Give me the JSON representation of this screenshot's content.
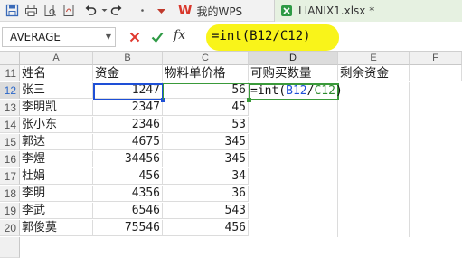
{
  "toolbar": {
    "icons": [
      "save-icon",
      "print-icon",
      "print-preview-icon",
      "export-pdf-icon",
      "undo-icon",
      "redo-icon",
      "customize-quick-access-icon"
    ]
  },
  "tabs": [
    {
      "label": "我的WPS",
      "active": false
    },
    {
      "label": "LIANIX1.xlsx *",
      "active": true
    }
  ],
  "formula_bar": {
    "name_box": "AVERAGE",
    "fx_label": "fx",
    "formula": "=int(B12/C12)"
  },
  "sheet": {
    "columns": [
      "A",
      "B",
      "C",
      "D",
      "E",
      "F"
    ],
    "row_numbers": [
      "11",
      "12",
      "13",
      "14",
      "15",
      "16",
      "17",
      "18",
      "19",
      "20"
    ],
    "header_row": [
      "姓名",
      "资金",
      "物料单价格",
      "可购买数量",
      "剩余资金",
      ""
    ],
    "rows": [
      {
        "name": "张三",
        "fund": "1247",
        "price": "56"
      },
      {
        "name": "李明凯",
        "fund": "2347",
        "price": "45"
      },
      {
        "name": "张小东",
        "fund": "2346",
        "price": "53"
      },
      {
        "name": "郭达",
        "fund": "4675",
        "price": "345"
      },
      {
        "name": "李煜",
        "fund": "34456",
        "price": "345"
      },
      {
        "name": "杜娟",
        "fund": "456",
        "price": "34"
      },
      {
        "name": "李明",
        "fund": "4356",
        "price": "36"
      },
      {
        "name": "李武",
        "fund": "6546",
        "price": "543"
      },
      {
        "name": "郭俊莫",
        "fund": "75546",
        "price": "456"
      }
    ],
    "editing_cell": {
      "prefix": "=int(",
      "ref1": "B12",
      "sep": "/",
      "ref2": "C12",
      "suffix": ")"
    }
  },
  "colors": {
    "highlight": "#f9f41a",
    "ref_blue": "#1e4fd6",
    "ref_green": "#3a9a3a",
    "active_tab": "#e6f1e1"
  }
}
